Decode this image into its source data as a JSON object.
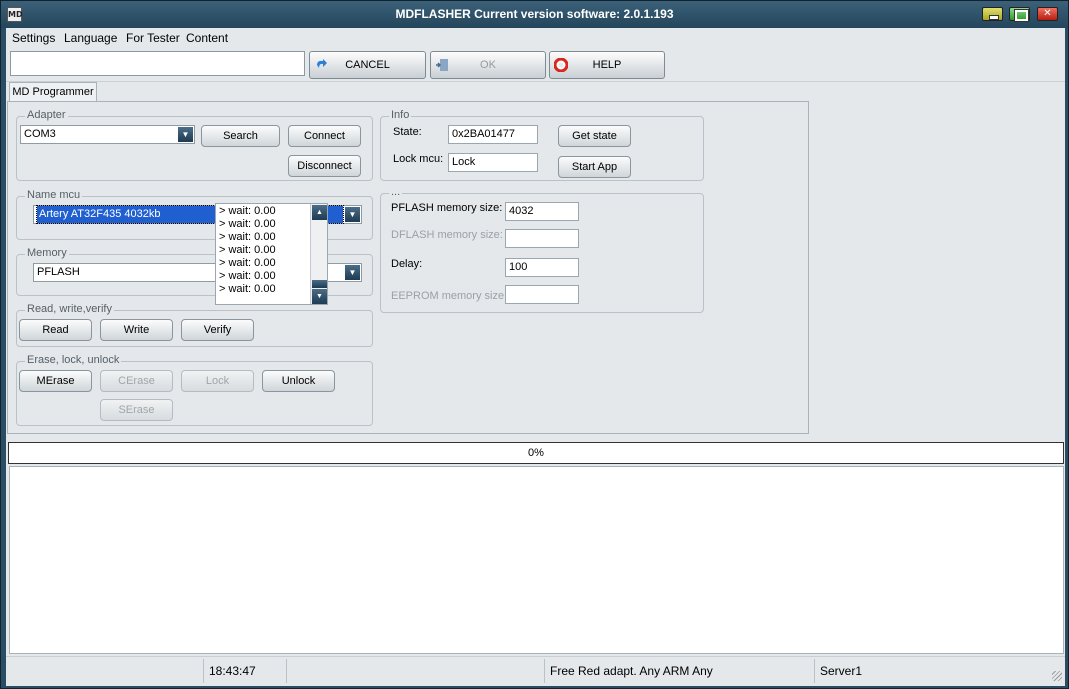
{
  "window": {
    "title": "MDFLASHER  Current version software: 2.0.1.193",
    "app_icon_text": "MD"
  },
  "menu": [
    "Settings",
    "Language",
    "For Tester",
    "Content"
  ],
  "toolbar": {
    "input_value": "",
    "cancel_label": "CANCEL",
    "ok_label": "OK",
    "help_label": "HELP"
  },
  "tab": {
    "label": "MD Programmer"
  },
  "adapter": {
    "legend": "Adapter",
    "port": "COM3",
    "search": "Search",
    "connect": "Connect",
    "disconnect": "Disconnect"
  },
  "mcu": {
    "legend": "Name mcu",
    "value": "Artery AT32F435 4032kb"
  },
  "memory": {
    "legend": "Memory",
    "value": "PFLASH"
  },
  "rwv": {
    "legend": "Read, write,verify",
    "read": "Read",
    "write": "Write",
    "verify": "Verify"
  },
  "erase": {
    "legend": "Erase, lock, unlock",
    "merase": "MErase",
    "cerase": "CErase",
    "lock": "Lock",
    "unlock": "Unlock",
    "serase": "SErase"
  },
  "info": {
    "legend": "Info",
    "state_label": "State:",
    "state_value": "0x2BA01477",
    "lock_label": "Lock mcu:",
    "lock_value": "Lock",
    "get_state": "Get state",
    "start_app": "Start App"
  },
  "params": {
    "legend": "...",
    "pflash_label": "PFLASH memory size:",
    "pflash_value": "4032",
    "dflash_label": "DFLASH memory size:",
    "dflash_value": "",
    "delay_label": "Delay:",
    "delay_value": "100",
    "eeprom_label": "EEPROM memory size:",
    "eeprom_value": ""
  },
  "log_lines": [
    "> wait: 0.00",
    "> wait: 0.00",
    "> wait: 0.00",
    "> wait: 0.00",
    "> wait: 0.00",
    "> wait: 0.00",
    "> wait: 0.00"
  ],
  "progress": {
    "text": "0%",
    "value": 0
  },
  "status": {
    "time": "18:43:47",
    "license": "Free Red adapt. Any ARM Any",
    "server": "Server1"
  }
}
